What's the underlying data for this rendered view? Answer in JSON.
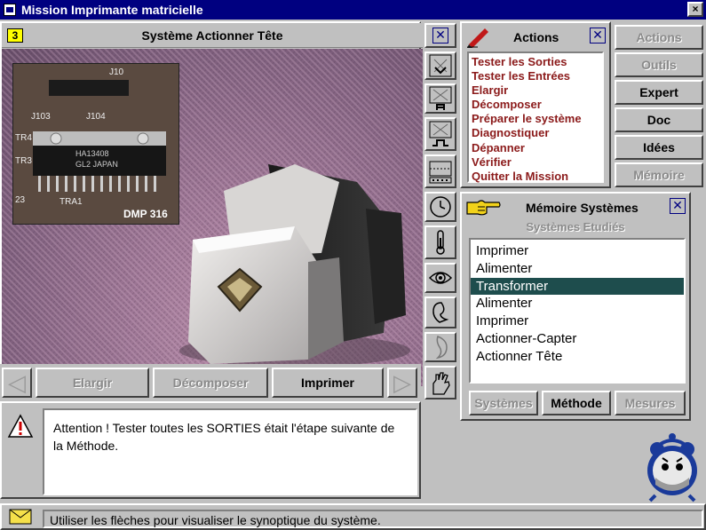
{
  "window": {
    "title": "Mission Imprimante matricielle",
    "close": "×"
  },
  "system_view": {
    "step": "3",
    "title": "Système  Actionner Tête",
    "inset_labels": [
      "J10",
      "J103",
      "J104",
      "TR4",
      "TR3",
      "HA13408",
      "GL2  JAPAN",
      "23",
      "TRA1",
      "DMP 316"
    ]
  },
  "nav": {
    "prev": "◁",
    "next": "▷",
    "buttons": [
      {
        "label": "Elargir",
        "enabled": false
      },
      {
        "label": "Décomposer",
        "enabled": false
      },
      {
        "label": "Imprimer",
        "enabled": true
      }
    ]
  },
  "toolbar": [
    "close-icon",
    "zoom-down-icon",
    "zoom-single-icon",
    "zoom-connect-icon",
    "gauge-icon",
    "clock-icon",
    "thermometer-icon",
    "eye-icon",
    "ear-icon",
    "nose-icon",
    "hand-icon"
  ],
  "actions": {
    "title": "Actions",
    "items": [
      "Tester les Sorties",
      "Tester les Entrées",
      "Elargir",
      "Décomposer",
      "Préparer le système",
      "Diagnostiquer",
      "Dépanner",
      "Vérifier",
      "Quitter la Mission"
    ]
  },
  "side_buttons": [
    {
      "label": "Actions",
      "enabled": false
    },
    {
      "label": "Outils",
      "enabled": false
    },
    {
      "label": "Expert",
      "enabled": true
    },
    {
      "label": "Doc",
      "enabled": true
    },
    {
      "label": "Idées",
      "enabled": true
    },
    {
      "label": "Mémoire",
      "enabled": false
    }
  ],
  "memoire": {
    "title": "Mémoire Systèmes",
    "subtitle": "Systèmes Etudiés",
    "items": [
      "Imprimer",
      "Alimenter",
      "Transformer",
      "Alimenter",
      "Imprimer",
      "Actionner-Capter",
      "Actionner Tête"
    ],
    "selected_index": 2,
    "buttons": [
      {
        "label": "Systèmes",
        "enabled": false
      },
      {
        "label": "Méthode",
        "enabled": true
      },
      {
        "label": "Mesures",
        "enabled": false
      }
    ]
  },
  "message": {
    "text": "Attention ! Tester toutes les SORTIES était l'étape suivante de la Méthode."
  },
  "status": {
    "text": "Utiliser les flèches pour visualiser le synoptique du système."
  },
  "colors": {
    "titlebar": "#000080",
    "selection": "#1e4d4d",
    "action_text": "#8b1a1a",
    "badge": "#ffff00"
  }
}
